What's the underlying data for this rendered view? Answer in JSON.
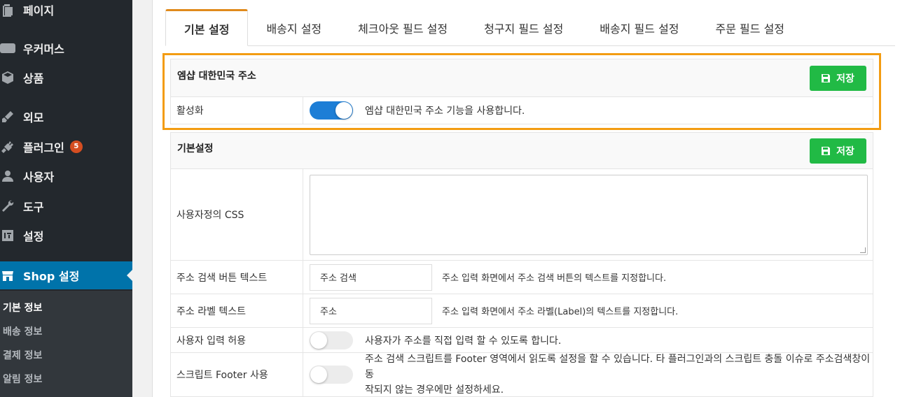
{
  "sidebar": {
    "items": [
      {
        "label": "페이지",
        "icon": "page-icon"
      },
      {
        "label": "우커머스",
        "icon": "woo-icon",
        "icon_text": "Woo"
      },
      {
        "label": "상품",
        "icon": "box-icon"
      },
      {
        "label": "외모",
        "icon": "brush-icon"
      },
      {
        "label": "플러그인",
        "icon": "plug-icon",
        "badge": "5"
      },
      {
        "label": "사용자",
        "icon": "user-icon"
      },
      {
        "label": "도구",
        "icon": "wrench-icon"
      },
      {
        "label": "설정",
        "icon": "settings-icon"
      },
      {
        "label": "Shop 설정",
        "icon": "shop-icon"
      }
    ],
    "submenu": [
      "기본 정보",
      "배송 정보",
      "결제 정보",
      "알림 정보"
    ]
  },
  "tabs": [
    "기본 설정",
    "배송지 설정",
    "체크아웃 필드 설정",
    "청구지 필드 설정",
    "배송지 필드 설정",
    "주문 필드 설정"
  ],
  "section1": {
    "title": "엠샵 대한민국 주소",
    "save_label": "저장",
    "row_label": "활성화",
    "row_desc": "엠샵 대한민국 주소 기능을 사용합니다.",
    "toggle_on": true
  },
  "section2": {
    "title": "기본설정",
    "save_label": "저장",
    "css_label": "사용자정의 CSS",
    "search_btn_label": "주소 검색 버튼 텍스트",
    "search_btn_value": "주소 검색",
    "search_btn_desc": "주소 입력 화면에서 주소 검색 버튼의 텍스트를 지정합니다.",
    "addr_label_label": "주소 라벨 텍스트",
    "addr_label_value": "주소",
    "addr_label_desc": "주소 입력 화면에서 주소 라벨(Label)의 텍스트를 지정합니다.",
    "user_input_label": "사용자 입력 허용",
    "user_input_desc": "사용자가 주소를 직접 입력 할 수 있도록 합니다.",
    "footer_label": "스크립트 Footer 사용",
    "footer_desc_1": "주소 검색 스크립트를 Footer 영역에서 읽도록 설정을 할 수 있습니다. 타 플러그인과의 스크립트 충돌 이슈로 주소검색창이 동",
    "footer_desc_2": "작되지 않는 경우에만 설정하세요."
  },
  "colors": {
    "accent": "#0073aa",
    "save_green": "#21ba45",
    "toggle_on": "#1d7ed6",
    "highlight": "#f39c12",
    "tab_top": "#e08a1c"
  }
}
